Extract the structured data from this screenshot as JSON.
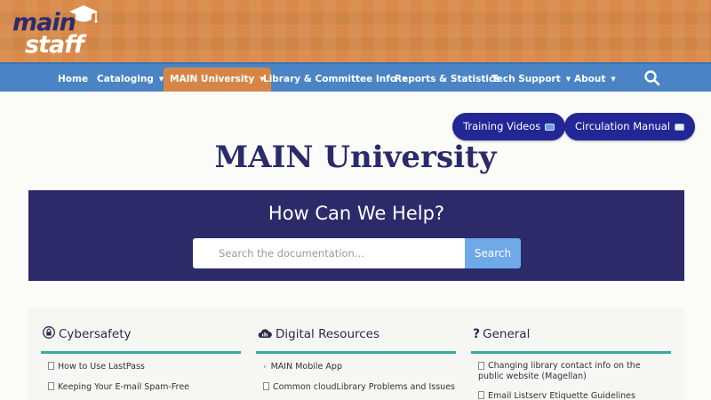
{
  "logo": {
    "main": "main",
    "staff": "staff"
  },
  "nav": {
    "items": [
      {
        "label": "Home",
        "dropdown": false
      },
      {
        "label": "Cataloging",
        "dropdown": true
      },
      {
        "label": "MAIN University",
        "dropdown": true,
        "active": true
      },
      {
        "label": "Library & Committee Info",
        "dropdown": true
      },
      {
        "label": "Reports & Statistics",
        "dropdown": false
      },
      {
        "label": "Tech Support",
        "dropdown": true
      },
      {
        "label": "About",
        "dropdown": true
      }
    ],
    "caret": "▼",
    "search_icon": "search-icon"
  },
  "buttons": {
    "training_videos": "Training Videos",
    "circulation_manual": "Circulation Manual"
  },
  "page_title": "MAIN University",
  "help": {
    "title": "How Can We Help?",
    "search_placeholder": "Search the documentation...",
    "search_button": "Search"
  },
  "categories": [
    {
      "title": "Cybersafety",
      "icon": "lock-icon",
      "links": [
        "How to Use LastPass",
        "Keeping Your E-mail Spam-Free"
      ]
    },
    {
      "title": "Digital Resources",
      "icon": "cloud-chart-icon",
      "links": [
        "MAIN Mobile App",
        "Common cloudLibrary Problems and Issues"
      ]
    },
    {
      "title": "General",
      "icon": "question-icon",
      "links": [
        "Changing library contact info on the public website (Magellan)",
        "Email Listserv Etiquette Guidelines"
      ]
    }
  ],
  "colors": {
    "banner": "#d98a4a",
    "nav": "#4a84c4",
    "active_tab": "#d58646",
    "brand_navy": "#2d2a6a",
    "button": "#232796",
    "accent_teal": "#3aa9a4",
    "search_button": "#6fa9e8"
  }
}
